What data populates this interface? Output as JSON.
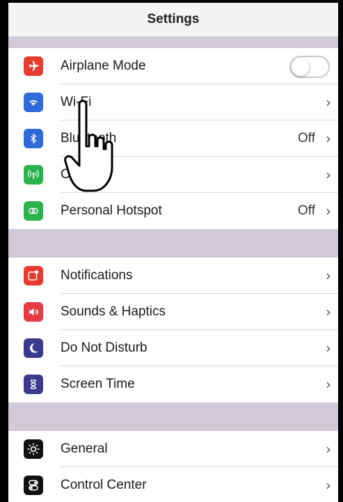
{
  "header": {
    "title": "Settings"
  },
  "sections": [
    {
      "rows": [
        {
          "label": "Airplane Mode",
          "icon": "airplane-icon",
          "color": "#e63b2e",
          "accessory": "toggle",
          "toggle_on": false
        },
        {
          "label": "Wi-Fi",
          "icon": "wifi-icon",
          "color": "#2f6bd8",
          "accessory": "chevron"
        },
        {
          "label": "Bluetooth",
          "icon": "bluetooth-icon",
          "color": "#2f6bd8",
          "value": "Off",
          "accessory": "chevron"
        },
        {
          "label": "Cellular",
          "icon": "cellular-icon",
          "color": "#2bb24c",
          "accessory": "chevron"
        },
        {
          "label": "Personal Hotspot",
          "icon": "hotspot-icon",
          "color": "#2bb24c",
          "value": "Off",
          "accessory": "chevron"
        }
      ]
    },
    {
      "rows": [
        {
          "label": "Notifications",
          "icon": "notifications-icon",
          "color": "#e63b2e",
          "accessory": "chevron"
        },
        {
          "label": "Sounds & Haptics",
          "icon": "sound-icon",
          "color": "#e63b45",
          "accessory": "chevron"
        },
        {
          "label": "Do Not Disturb",
          "icon": "moon-icon",
          "color": "#3b3a8c",
          "accessory": "chevron"
        },
        {
          "label": "Screen Time",
          "icon": "hourglass-icon",
          "color": "#3b3a8c",
          "accessory": "chevron"
        }
      ]
    },
    {
      "rows": [
        {
          "label": "General",
          "icon": "gear-icon",
          "color": "#111111",
          "accessory": "chevron"
        },
        {
          "label": "Control Center",
          "icon": "toggles-icon",
          "color": "#111111",
          "accessory": "chevron"
        }
      ]
    }
  ],
  "chevron_glyph": "›"
}
